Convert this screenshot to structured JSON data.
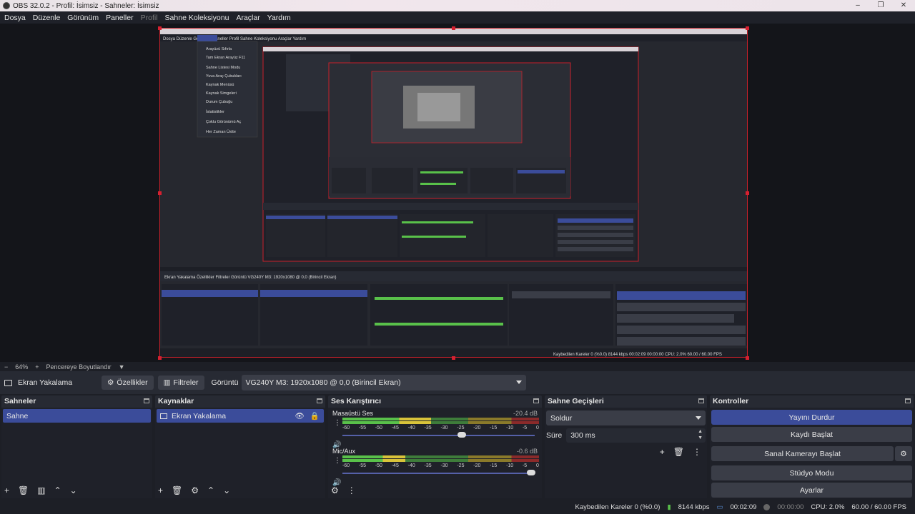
{
  "window": {
    "title": "OBS 32.0.2 - Profil: İsimsiz - Sahneler: İsimsiz",
    "minimize": "–",
    "maximize": "❐",
    "close": "✕"
  },
  "menu": {
    "items": [
      "Dosya",
      "Düzenle",
      "Görünüm",
      "Paneller",
      "Profil",
      "Sahne Koleksiyonu",
      "Araçlar",
      "Yardım"
    ]
  },
  "zoom": {
    "minus": "−",
    "value": "64%",
    "plus": "+",
    "mode": "Pencereye Boyutlandır"
  },
  "source_toolbar": {
    "source_name": "Ekran Yakalama",
    "properties_label": "Özellikler",
    "filters_label": "Filtreler",
    "display_label": "Görüntü",
    "display_value": "VG240Y M3: 1920x1080 @ 0,0 (Birincil Ekran)"
  },
  "scenes": {
    "title": "Sahneler",
    "items": [
      {
        "label": "Sahne",
        "selected": true
      }
    ]
  },
  "sources": {
    "title": "Kaynaklar",
    "items": [
      {
        "label": "Ekran Yakalama",
        "selected": true
      }
    ]
  },
  "mixer": {
    "title": "Ses Karıştırıcı",
    "channels": [
      {
        "name": "Masaüstü Ses",
        "db": "-20.4 dB",
        "level": 0.45,
        "volume": 0.62
      },
      {
        "name": "Mic/Aux",
        "db": "-0.6 dB",
        "level": 0.32,
        "volume": 0.98
      }
    ],
    "ticks": [
      "-60",
      "-55",
      "-50",
      "-45",
      "-40",
      "-35",
      "-30",
      "-25",
      "-20",
      "-15",
      "-10",
      "-5",
      "0"
    ]
  },
  "transitions": {
    "title": "Sahne Geçişleri",
    "selected": "Soldur",
    "duration_label": "Süre",
    "duration_value": "300 ms"
  },
  "controls": {
    "title": "Kontroller",
    "stop_stream": "Yayını Durdur",
    "start_record": "Kaydı Başlat",
    "virtual_cam": "Sanal Kamerayı Başlat",
    "studio_mode": "Stüdyo Modu",
    "settings": "Ayarlar"
  },
  "status": {
    "dropped_frames": "Kaybedilen Kareler 0 (%0.0)",
    "bitrate": "8144 kbps",
    "stream_time": "00:02:09",
    "record_time": "00:00:00",
    "cpu": "CPU: 2.0%",
    "fps": "60.00 / 60.00 FPS"
  },
  "nested_preview": {
    "menu_items": [
      "Arayüzü Sıfırla",
      "Tam Ekran Arayüz",
      "Sahne Listesi Modu",
      "Yuva Araç Çubukları",
      "Kaynak Menüsü",
      "Kaynak Simgeleri",
      "Durum Çubuğu",
      "İstatistikler",
      "Çoklu Görünümü Aç",
      "Her Zaman Üstte"
    ],
    "menu_shortcut": "F11"
  },
  "colors": {
    "accent": "#3b4c9a",
    "panel": "#272a33",
    "bg": "#1f2129",
    "preview_border": "#c8202a"
  }
}
